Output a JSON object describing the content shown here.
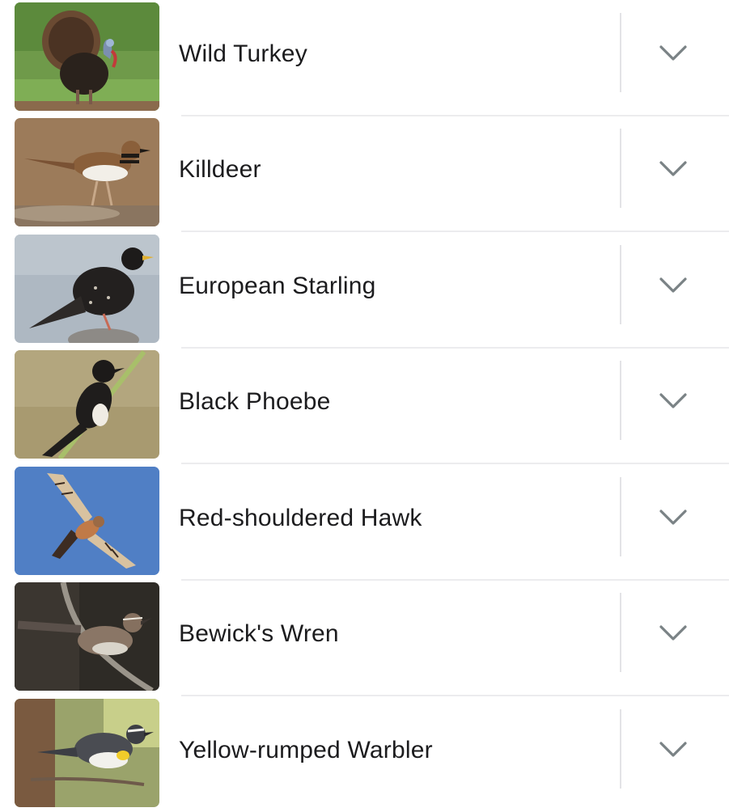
{
  "birds": [
    {
      "name": "Wild Turkey",
      "photo_icon": "wild-turkey-photo"
    },
    {
      "name": "Killdeer",
      "photo_icon": "killdeer-photo"
    },
    {
      "name": "European Starling",
      "photo_icon": "european-starling-photo"
    },
    {
      "name": "Black Phoebe",
      "photo_icon": "black-phoebe-photo"
    },
    {
      "name": "Red-shouldered Hawk",
      "photo_icon": "red-shouldered-hawk-photo"
    },
    {
      "name": "Bewick's Wren",
      "photo_icon": "bewicks-wren-photo"
    },
    {
      "name": "Yellow-rumped Warbler",
      "photo_icon": "yellow-rumped-warbler-photo"
    }
  ],
  "expand_icon": "chevron-down-icon",
  "colors": {
    "text": "#1c1c1e",
    "chevron": "#7a8285",
    "divider": "#e3e3e6"
  }
}
